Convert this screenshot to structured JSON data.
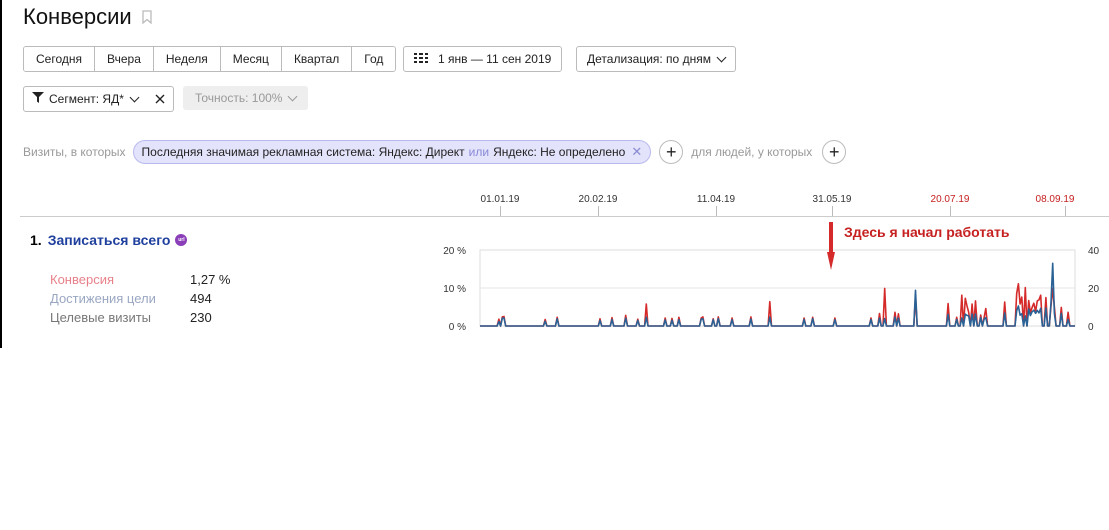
{
  "page": {
    "title": "Конверсии"
  },
  "periods": [
    "Сегодня",
    "Вчера",
    "Неделя",
    "Месяц",
    "Квартал",
    "Год"
  ],
  "date_range": "1 янв — 11 сен 2019",
  "detail": "Детализация: по дням",
  "segment": "Сегмент: ЯД*",
  "accuracy": "Точность: 100%",
  "filter": {
    "prefix": "Визиты, в которых",
    "tag_part1": "Последняя значимая рекламная система: Яндекс: Директ",
    "tag_or": "или",
    "tag_part2": "Яндекс: Не определено",
    "suffix": "для людей, у которых"
  },
  "timeline_dates": [
    {
      "label": "01.01.19",
      "red": false
    },
    {
      "label": "20.02.19",
      "red": false
    },
    {
      "label": "11.04.19",
      "red": false
    },
    {
      "label": "31.05.19",
      "red": false
    },
    {
      "label": "20.07.19",
      "red": true
    },
    {
      "label": "08.09.19",
      "red": true
    }
  ],
  "goal": {
    "index": "1.",
    "name": "Записаться всего",
    "badge": "url",
    "metrics": [
      {
        "label": "Конверсия",
        "value": "1,27 %",
        "color": "#e8808a"
      },
      {
        "label": "Достижения цели",
        "value": "494",
        "color": "#9aa7c2"
      },
      {
        "label": "Целевые визиты",
        "value": "230",
        "color": "#777777"
      }
    ]
  },
  "annotation": "Здесь я начал работать",
  "chart_data": {
    "type": "line",
    "y_left_ticks": [
      "20 %",
      "10 %",
      "0 %"
    ],
    "y_right_ticks": [
      "40",
      "20",
      "0"
    ],
    "ylim_left": [
      0,
      20
    ],
    "ylim_right": [
      0,
      40
    ],
    "x_range": [
      "01.01.19",
      "11.09.19"
    ],
    "series": [
      {
        "name": "Конверсия",
        "axis": "left",
        "color": "#d42a2a",
        "values": [
          0,
          0,
          0,
          0,
          0,
          0,
          0,
          0,
          0,
          0,
          0,
          1.8,
          0,
          2.4,
          2.5,
          0,
          0,
          0,
          0,
          0,
          0,
          0,
          0,
          0,
          0,
          0,
          0,
          0,
          0,
          0,
          0,
          0,
          0,
          0,
          0,
          0,
          0,
          0,
          1.7,
          0,
          0,
          0,
          0,
          0,
          0,
          2.3,
          0,
          0,
          0,
          0,
          0,
          0,
          0,
          0,
          0,
          0,
          0,
          0,
          0,
          0,
          0,
          0,
          0,
          0,
          0,
          0,
          0,
          0,
          0,
          0,
          1.9,
          0,
          0,
          0,
          0,
          0,
          0,
          2.2,
          0,
          0,
          0,
          0,
          0,
          0,
          0,
          2.8,
          0,
          0,
          0,
          0,
          0,
          0,
          1.8,
          0,
          0,
          0,
          0,
          5.8,
          0,
          0,
          0,
          0,
          0,
          0,
          0,
          0,
          0,
          0,
          2.1,
          0,
          0,
          0,
          2.0,
          0,
          0,
          0,
          2.3,
          0,
          0,
          0,
          0,
          0,
          0,
          0,
          0,
          0,
          0,
          0,
          0,
          2.1,
          2.4,
          0,
          0,
          0,
          0,
          0,
          1.9,
          0,
          0,
          2.4,
          0,
          0,
          0,
          0,
          0,
          0,
          0,
          2.1,
          0,
          0,
          0,
          0,
          0,
          0,
          0,
          0,
          0,
          0,
          2.4,
          0,
          0,
          0,
          0,
          0,
          0,
          0,
          0,
          0,
          0,
          6.4,
          0,
          0,
          0,
          0,
          0,
          0,
          0,
          0,
          0,
          0,
          0,
          0,
          0,
          0,
          0,
          0,
          0,
          0,
          0,
          2.1,
          0,
          0,
          0,
          0,
          2.3,
          0,
          0,
          0,
          0,
          0,
          0,
          0,
          0,
          0,
          0,
          0,
          0,
          2.1,
          0,
          0,
          0,
          0,
          0,
          0,
          0,
          0,
          0,
          0,
          0,
          0,
          0,
          0,
          0,
          0,
          0,
          0,
          0,
          0,
          2.1,
          0,
          0,
          0,
          0,
          3.3,
          0,
          0,
          9.9,
          0,
          0,
          0,
          0,
          0,
          3.6,
          0,
          3.2,
          0,
          0,
          0,
          0,
          0,
          0,
          0,
          0,
          0,
          7.7,
          0,
          0,
          0,
          0,
          0,
          0,
          0,
          0,
          0,
          0,
          0,
          0,
          0,
          0,
          0,
          0,
          0,
          0,
          5.9,
          0,
          0,
          0,
          0,
          2.3,
          0,
          0,
          8.1,
          0,
          7.3,
          5.3,
          3.6,
          0,
          5.8,
          0,
          6.6,
          0,
          0,
          2.9,
          0,
          2.2,
          4.6,
          0,
          0,
          0,
          0,
          0,
          0,
          0,
          0,
          0,
          0,
          6.3,
          0,
          0,
          0,
          0,
          0,
          0,
          8.6,
          11.1,
          5.8,
          7.6,
          0,
          10.1,
          0,
          6.7,
          3.4,
          4.9,
          6.0,
          3.9,
          6.6,
          6.9,
          8.1,
          0,
          0,
          7.5,
          0,
          0,
          5.3,
          9.9,
          5.0,
          0,
          0,
          0,
          4.9,
          0,
          0,
          0,
          3.6,
          0,
          0,
          0,
          0
        ]
      },
      {
        "name": "Целевые визиты",
        "axis": "right",
        "color": "#2a6296",
        "values": [
          0,
          0,
          0,
          0,
          0,
          0,
          0,
          0,
          0,
          0,
          0,
          2.3,
          0,
          4.1,
          4.2,
          0,
          0,
          0,
          0,
          0,
          0,
          0,
          0,
          0,
          0,
          0,
          0,
          0,
          0,
          0,
          0,
          0,
          0,
          0,
          0,
          0,
          0,
          0,
          2.5,
          0,
          0,
          0,
          0,
          0,
          0,
          3.8,
          0,
          0,
          0,
          0,
          0,
          0,
          0,
          0,
          0,
          0,
          0,
          0,
          0,
          0,
          0,
          0,
          0,
          0,
          0,
          0,
          0,
          0,
          0,
          0,
          2.9,
          0,
          0,
          0,
          0,
          0,
          0,
          3.4,
          0,
          0,
          0,
          0,
          0,
          0,
          0,
          4.1,
          0,
          0,
          0,
          0,
          0,
          0,
          2.9,
          0,
          0,
          0,
          0,
          4.6,
          0,
          0,
          0,
          0,
          0,
          0,
          0,
          0,
          0,
          0,
          3.2,
          0,
          0,
          0,
          3.0,
          0,
          0,
          0,
          3.3,
          0,
          0,
          0,
          0,
          0,
          0,
          0,
          0,
          0,
          0,
          0,
          0,
          3.6,
          3.8,
          0,
          0,
          0,
          0,
          0,
          3.3,
          0,
          0,
          3.9,
          0,
          0,
          0,
          0,
          0,
          0,
          0,
          3.3,
          0,
          0,
          0,
          0,
          0,
          0,
          0,
          0,
          0,
          0,
          3.7,
          0,
          0,
          0,
          0,
          0,
          0,
          0,
          0,
          0,
          0,
          4.7,
          0,
          0,
          0,
          0,
          0,
          0,
          0,
          0,
          0,
          0,
          0,
          0,
          0,
          0,
          0,
          0,
          0,
          0,
          0,
          3.4,
          0,
          0,
          0,
          0,
          3.9,
          0,
          0,
          0,
          0,
          0,
          0,
          0,
          0,
          0,
          0,
          0,
          0,
          3.3,
          0,
          0,
          0,
          0,
          0,
          0,
          0,
          0,
          0,
          0,
          0,
          0,
          0,
          0,
          0,
          0,
          0,
          0,
          0,
          0,
          3.4,
          0,
          0,
          0,
          0,
          4.1,
          0,
          0,
          3.9,
          0,
          0,
          0,
          0,
          0,
          4.7,
          0,
          4.2,
          0,
          0,
          0,
          0,
          0,
          0,
          0,
          0,
          0,
          18.8,
          0,
          0,
          0,
          0,
          0,
          0,
          0,
          0,
          0,
          0,
          0,
          0,
          0,
          0,
          0,
          0,
          0,
          0,
          6.1,
          0,
          0,
          0,
          0,
          3.4,
          0,
          0,
          4.2,
          0,
          6.2,
          5.6,
          5.3,
          0,
          6.3,
          0,
          6.2,
          0,
          0,
          4.5,
          0,
          3.5,
          4.4,
          0,
          0,
          0,
          0,
          0,
          0,
          0,
          0,
          0,
          0,
          6.8,
          0,
          0,
          0,
          0,
          0,
          0,
          8.1,
          10.5,
          5.7,
          6.5,
          0,
          5.3,
          0,
          8.9,
          5.5,
          7.5,
          8.3,
          6.7,
          8.2,
          6.9,
          9.3,
          0,
          0,
          9.4,
          0,
          0,
          12.5,
          33.0,
          6.5,
          0,
          0,
          0,
          6.7,
          0,
          0,
          0,
          3.4,
          0,
          0,
          0,
          0
        ]
      }
    ]
  }
}
